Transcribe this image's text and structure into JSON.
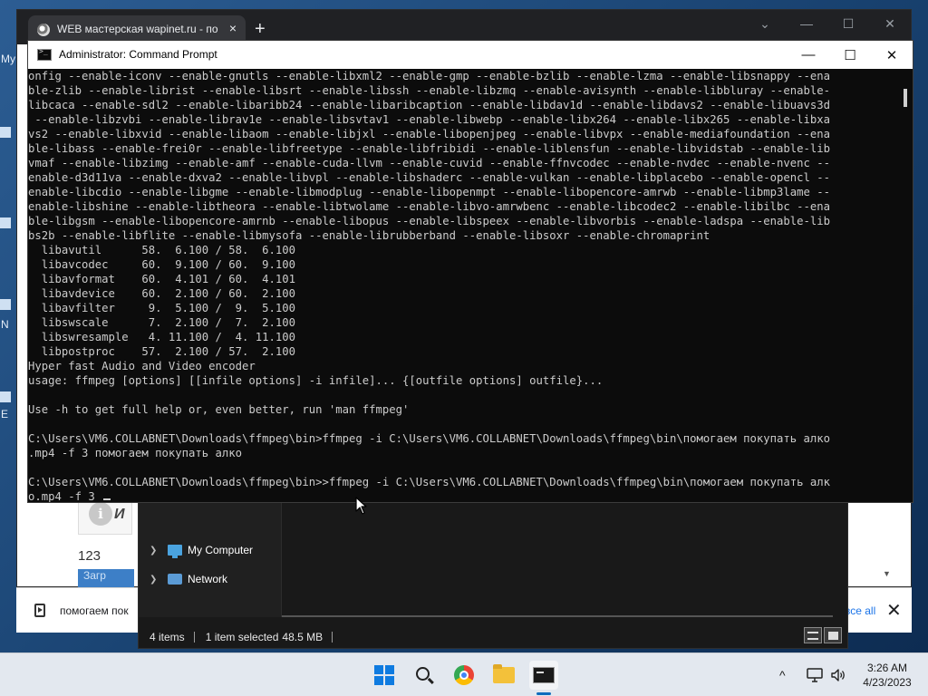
{
  "desktop": {
    "side_letters": [
      "My",
      "N",
      "E"
    ]
  },
  "browser": {
    "tab_title": "WEB мастерская wapinet.ru - по",
    "tab_close": "×",
    "new_tab": "+",
    "controls": [
      "⌄",
      "—",
      "☐",
      "✕"
    ],
    "page_info_letter": "И",
    "page_count": "123",
    "page_button": "Загр",
    "scroll_arrow": "▼"
  },
  "download_bar": {
    "file_name": "помогаем пок",
    "show_all": "все all",
    "close": "✕"
  },
  "explorer": {
    "nav_items": [
      {
        "label": "My Computer",
        "icon": "computer-icon"
      },
      {
        "label": "Network",
        "icon": "network-icon"
      }
    ],
    "status_items": "4 items",
    "status_selected": "1 item selected",
    "status_size": "48.5 MB"
  },
  "cmd": {
    "title": "Administrator: Command Prompt",
    "controls": [
      "—",
      "☐",
      "✕"
    ],
    "lines": [
      "onfig --enable-iconv --enable-gnutls --enable-libxml2 --enable-gmp --enable-bzlib --enable-lzma --enable-libsnappy --ena",
      "ble-zlib --enable-librist --enable-libsrt --enable-libssh --enable-libzmq --enable-avisynth --enable-libbluray --enable-",
      "libcaca --enable-sdl2 --enable-libaribb24 --enable-libaribcaption --enable-libdav1d --enable-libdavs2 --enable-libuavs3d",
      " --enable-libzvbi --enable-librav1e --enable-libsvtav1 --enable-libwebp --enable-libx264 --enable-libx265 --enable-libxa",
      "vs2 --enable-libxvid --enable-libaom --enable-libjxl --enable-libopenjpeg --enable-libvpx --enable-mediafoundation --ena",
      "ble-libass --enable-frei0r --enable-libfreetype --enable-libfribidi --enable-liblensfun --enable-libvidstab --enable-lib",
      "vmaf --enable-libzimg --enable-amf --enable-cuda-llvm --enable-cuvid --enable-ffnvcodec --enable-nvdec --enable-nvenc --",
      "enable-d3d11va --enable-dxva2 --enable-libvpl --enable-libshaderc --enable-vulkan --enable-libplacebo --enable-opencl --",
      "enable-libcdio --enable-libgme --enable-libmodplug --enable-libopenmpt --enable-libopencore-amrwb --enable-libmp3lame --",
      "enable-libshine --enable-libtheora --enable-libtwolame --enable-libvo-amrwbenc --enable-libcodec2 --enable-libilbc --ena",
      "ble-libgsm --enable-libopencore-amrnb --enable-libopus --enable-libspeex --enable-libvorbis --enable-ladspa --enable-lib",
      "bs2b --enable-libflite --enable-libmysofa --enable-librubberband --enable-libsoxr --enable-chromaprint",
      "  libavutil      58.  6.100 / 58.  6.100",
      "  libavcodec     60.  9.100 / 60.  9.100",
      "  libavformat    60.  4.101 / 60.  4.101",
      "  libavdevice    60.  2.100 / 60.  2.100",
      "  libavfilter     9.  5.100 /  9.  5.100",
      "  libswscale      7.  2.100 /  7.  2.100",
      "  libswresample   4. 11.100 /  4. 11.100",
      "  libpostproc    57.  2.100 / 57.  2.100",
      "Hyper fast Audio and Video encoder",
      "usage: ffmpeg [options] [[infile options] -i infile]... {[outfile options] outfile}...",
      "",
      "Use -h to get full help or, even better, run 'man ffmpeg'",
      "",
      "C:\\Users\\VM6.COLLABNET\\Downloads\\ffmpeg\\bin>ffmpeg -i C:\\Users\\VM6.COLLABNET\\Downloads\\ffmpeg\\bin\\помогаем покупать алко",
      ".mp4 -f 3 помогаем покупать алко",
      "",
      "C:\\Users\\VM6.COLLABNET\\Downloads\\ffmpeg\\bin>>ffmpeg -i C:\\Users\\VM6.COLLABNET\\Downloads\\ffmpeg\\bin\\помогаем покупать алк",
      "o.mp4 -f 3 "
    ]
  },
  "taskbar": {
    "apps": [
      "start-icon",
      "search-icon",
      "chrome-icon",
      "file-explorer-icon",
      "command-prompt-icon"
    ],
    "tray_chevron": "^",
    "time": "3:26 AM",
    "date": "4/23/2023"
  }
}
